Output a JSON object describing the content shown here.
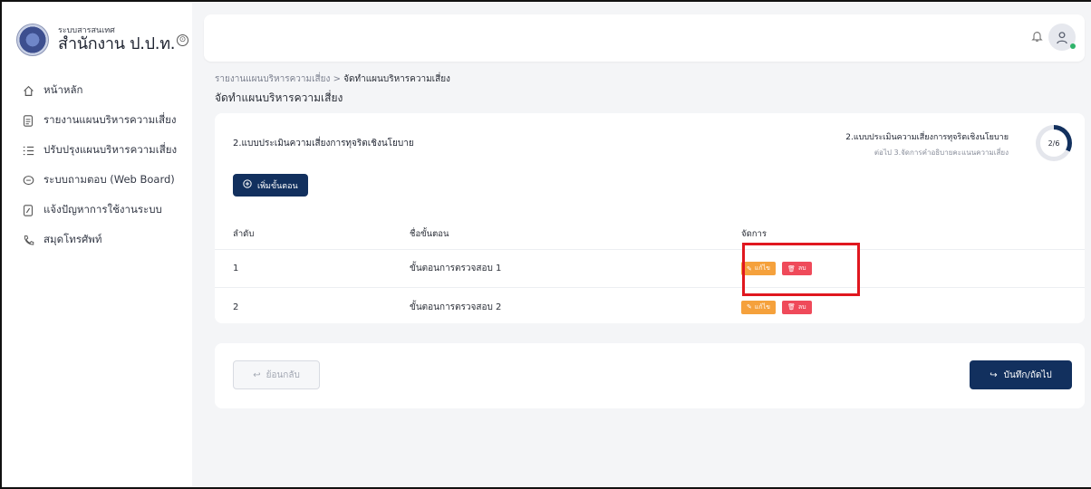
{
  "sidebar": {
    "brand_sub": "ระบบสารสนเทศ",
    "brand_main": "สำนักงาน ป.ป.ท.",
    "toggle": "⊙",
    "items": [
      {
        "label": "หน้าหลัก",
        "icon": "home-icon"
      },
      {
        "label": "รายงานแผนบริหารความเสี่ยง",
        "icon": "document-icon"
      },
      {
        "label": "ปรับปรุงแผนบริหารความเสี่ยง",
        "icon": "checklist-icon"
      },
      {
        "label": "ระบบถามตอบ (Web Board)",
        "icon": "chat-icon"
      },
      {
        "label": "แจ้งปัญหาการใช้งานระบบ",
        "icon": "edit-doc-icon"
      },
      {
        "label": "สมุดโทรศัพท์",
        "icon": "phone-icon"
      }
    ]
  },
  "breadcrumb": {
    "parent": "รายงานแผนบริหารความเสี่ยง",
    "separator": " > ",
    "current": "จัดทำแผนบริหารความเสี่ยง"
  },
  "page_title": "จัดทำแผนบริหารความเสี่ยง",
  "card": {
    "title": "2.แบบประเมินความเสี่ยงการทุจริตเชิงนโยบาย",
    "step_title": "2.แบบประเมินความเสี่ยงการทุจริตเชิงนโยบาย",
    "step_next": "ต่อไป 3.จัดการคำอธิบายคะแนนความเสี่ยง",
    "progress_label": "2/6",
    "progress_fraction": 0.333,
    "add_button": "เพิ่มขั้นตอน",
    "columns": [
      "ลำดับ",
      "ชื่อขั้นตอน",
      "จัดการ"
    ],
    "rows": [
      {
        "no": "1",
        "name": "ขั้นตอนการตรวจสอบ 1",
        "edit": "แก้ไข",
        "delete": "ลบ"
      },
      {
        "no": "2",
        "name": "ขั้นตอนการตรวจสอบ 2",
        "edit": "แก้ไข",
        "delete": "ลบ"
      }
    ]
  },
  "footer": {
    "back_button": "ย้อนกลับ",
    "next_button": "บันทึก/ถัดไป"
  },
  "colors": {
    "primary": "#12305e",
    "edit": "#f5a13c",
    "delete": "#ef4a5a",
    "highlight": "#e0171f"
  }
}
